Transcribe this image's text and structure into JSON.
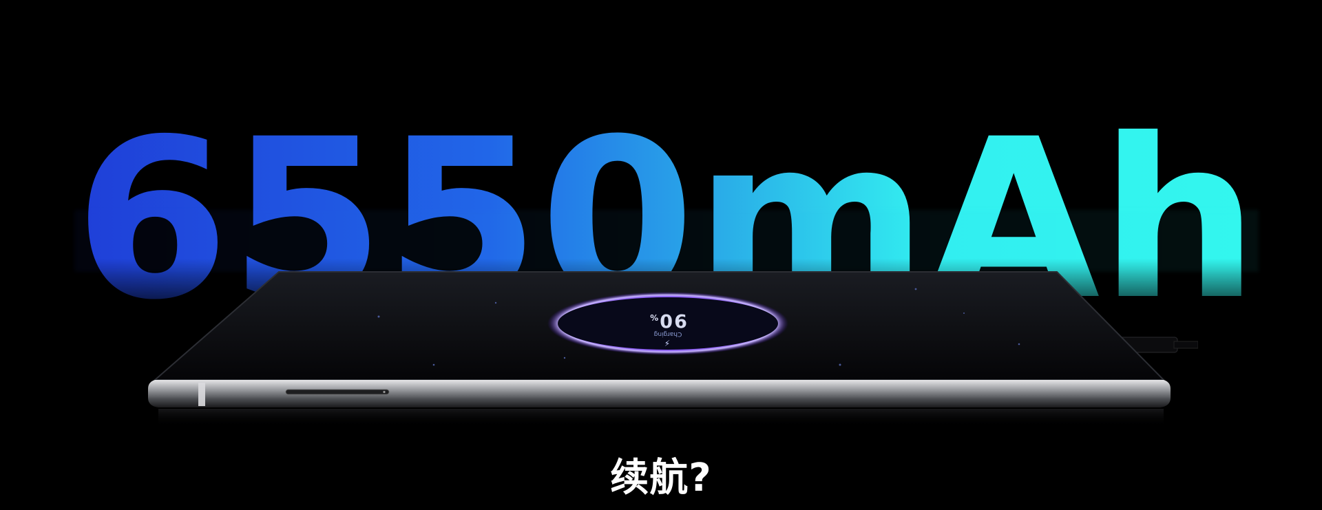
{
  "headline": {
    "digits": "6550",
    "unit": "mAh"
  },
  "screen": {
    "battery_percent": "90",
    "percent_sign": "%",
    "status": "Charging",
    "bolt": "⚡"
  },
  "caption": "续航?"
}
